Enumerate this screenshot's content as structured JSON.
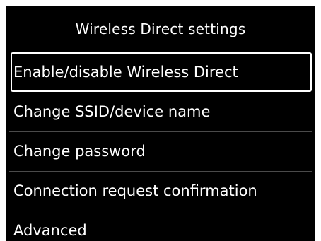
{
  "screen": {
    "title": "Wireless Direct settings",
    "items": [
      {
        "label": "Enable/disable Wireless Direct",
        "selected": true
      },
      {
        "label": "Change SSID/device name",
        "selected": false
      },
      {
        "label": "Change password",
        "selected": false
      },
      {
        "label": "Connection request confirmation",
        "selected": false
      },
      {
        "label": "Advanced",
        "selected": false
      }
    ]
  }
}
